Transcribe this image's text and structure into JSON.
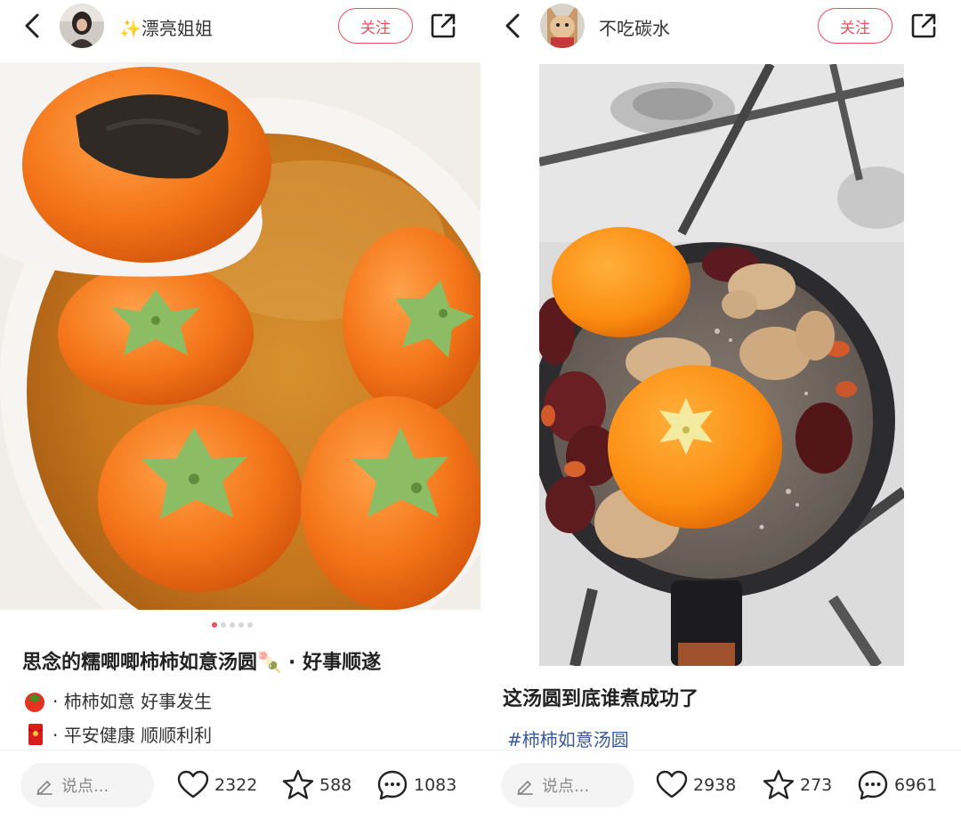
{
  "left_post": {
    "username": "✨漂亮姐姐",
    "follow_label": "关注",
    "carousel": {
      "total": 5,
      "active": 1
    },
    "title": "思念的糯唧唧柿柿如意汤圆🍡 · 好事顺遂",
    "lines": [
      {
        "icon": "tomato-emoji-icon",
        "text": "· 柿柿如意 好事发生"
      },
      {
        "icon": "red-envelope-emoji-icon",
        "text": "· 平安健康 顺顺利利"
      }
    ],
    "comment_placeholder": "说点...",
    "likes": "2322",
    "collects": "588",
    "comments": "1083"
  },
  "right_post": {
    "username": "不吃碳水",
    "follow_label": "关注",
    "title": "这汤圆到底谁煮成功了",
    "hashtag": "#柿柿如意汤圆",
    "comment_placeholder": "说点...",
    "likes": "2938",
    "collects": "273",
    "comments": "6961"
  },
  "colors": {
    "accent": "#f04d5e",
    "hashtag": "#3b5998",
    "persimmon": "#f07a1c",
    "leaf": "#8fbf6a"
  }
}
